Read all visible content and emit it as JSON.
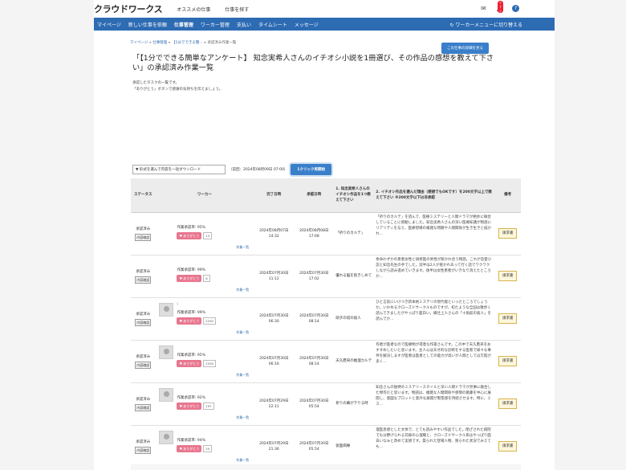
{
  "header": {
    "logo": "クラウドワークス",
    "links": [
      "オススメの仕事",
      "仕事を探す"
    ],
    "badge": "ﾜｸｼ"
  },
  "nav": {
    "items": [
      "マイページ",
      "新しい仕事を依頼",
      "仕事管理",
      "ワーカー管理",
      "支払い",
      "タイムシート",
      "メッセージ"
    ],
    "active_index": 2,
    "switch": "ワーカーメニューに切り替える"
  },
  "breadcrumb": {
    "items": [
      "マイページ",
      "仕事管理",
      "【1分でできる簡...",
      "承認済み作業一覧"
    ],
    "seps": [
      "»",
      "»",
      "»"
    ]
  },
  "detail_button": "この仕事の詳細を見る",
  "title": "「【1分でできる簡単なアンケート】 知念実希人さんのイチオシ小説を1冊選び、その作品の感想を教えて下さい」の承認済み作業一覧",
  "description": [
    "承認したタスクの一覧です。",
    "「ありがとう」ボタンで感謝の気持ちを伝えましょう。"
  ],
  "filter": {
    "select": "▼ 形式を選んで内容を一括ダウンロード",
    "date": "（前回：2024年08月09日 07:00）",
    "approve_button": "1クリック再開始"
  },
  "table": {
    "headers": [
      "ステータス",
      "ワーカー",
      "完了日時",
      "承認日時",
      "1. 知念実希人さんのイチオシ作品を1つ教えて下さい",
      "2. イチオシ作品を選んだ理由（感想でもOKです）を200文字以上で教えて下さい ※200文字以下は非承認",
      "備考"
    ],
    "rows": [
      {
        "status": "承認済み",
        "inner": "内容確認",
        "has_avatar": false,
        "name": "",
        "rate": "作業承認率: 95%",
        "thanks": "ありがとう",
        "count": "13",
        "list": "作業一覧",
        "completed": "2024年08月07日 14:32",
        "approved": "2024年08月08日 17:08",
        "q1": "「祈りのカルテ」",
        "q2": "「祈りのカルテ」を読んで、医療ミステリーと人間ドラマが絶妙に融合していることに感動しました。知念実希人さんの深い医療知識が物語にリアリティを与え、医療現場の複雑な問題や人間関係が生き生きと描かれ...",
        "note": "請求書"
      },
      {
        "status": "承認済み",
        "inner": "内容確認",
        "has_avatar": false,
        "name": "",
        "rate": "作業承認率: 99%",
        "thanks": "ありがとう",
        "count": "8",
        "list": "作業一覧",
        "completed": "2024年07月30日 11:12",
        "approved": "2024年07月30日 17:02",
        "q1": "優れる脳を抱きしめて",
        "q2": "余命わずかの患者女性と研修医の男性が惹かれ合う物語。これが恋愛小説と知念先生の手でした。前半は2人が惹かれあって行く話でワクワクしながら読み進めていきます。後半は女性患者がいきなり消えたところか...",
        "note": "請求書"
      },
      {
        "status": "承認済み",
        "inner": "内容確認",
        "has_avatar": true,
        "name": "l",
        "rate": "作業承認率: 99%",
        "thanks": "ありがとう",
        "count": "2250",
        "list": "作業一覧",
        "completed": "2024年07月30日 06:30",
        "approved": "2024年07月30日 08:14",
        "q1": "硝子の塔の殺人",
        "q2": "ひと言前にいけつき新本格ミステリの現代版といったところでしょうか。いわゆるクローズドサークルものですが、初たような全国は散歩く読んできましたがやっぱり面白い。縁仕上人さんの「十角館の殺人」を読んでか...",
        "note": "請求書"
      },
      {
        "status": "承認済み",
        "inner": "内容確認",
        "has_avatar": true,
        "name": "",
        "rate": "作業承認率: 95%",
        "thanks": "ありがとう",
        "count": "2530",
        "list": "作業一覧",
        "completed": "2024年07月30日 06:16",
        "approved": "2024年07月30日 08:14",
        "q1": "天久鷹央の推理カルテ",
        "q2": "作者が医者なので医療物が得意な作家さんです。この中で天久鷹央をおすすめしたいと思います。主人公は天才的な診断をする医者で様々な事件を解決しますが医者は医者としての能力が高いが人間としては欠陥が多く...",
        "note": "請求書"
      },
      {
        "status": "承認済み",
        "inner": "内容確認",
        "has_avatar": true,
        "name": "",
        "rate": "作業承認率: 92%",
        "thanks": "ありがとう",
        "count": "197",
        "list": "作業一覧",
        "completed": "2024年07月29日 22:11",
        "approved": "2024年07月30日 05:54",
        "q1": "祈りの幕が下りる時",
        "q2": "知念さんの独特のミステリースタイルと深い人間ドラマが見事に融合した傑作だと思います。物語は、複雑な人間関係や感情の葛藤を中心に展開し、意図なプロットと意外な展開が緊張感を持続させます。特に、ミス...",
        "note": "請求書"
      },
      {
        "status": "承認済み",
        "inner": "内容確認",
        "has_avatar": true,
        "name": "",
        "rate": "作業承認率: 94%",
        "thanks": "ありがとう",
        "count": "20",
        "list": "作業一覧",
        "completed": "2024年07月29日 21:36",
        "approved": "2024年07月30日 05:54",
        "q1": "仮面病棟",
        "q2": "理医思想とした文体で、とても読みやすい作品でした。閉ざされた病院でも分野げられる兄嫁の心理戦と、クローズドサークル系はやっぱり面白いなぁと改めて実感です。築られた登場人物、限られた状況でみえても...",
        "note": "請求書"
      }
    ]
  }
}
